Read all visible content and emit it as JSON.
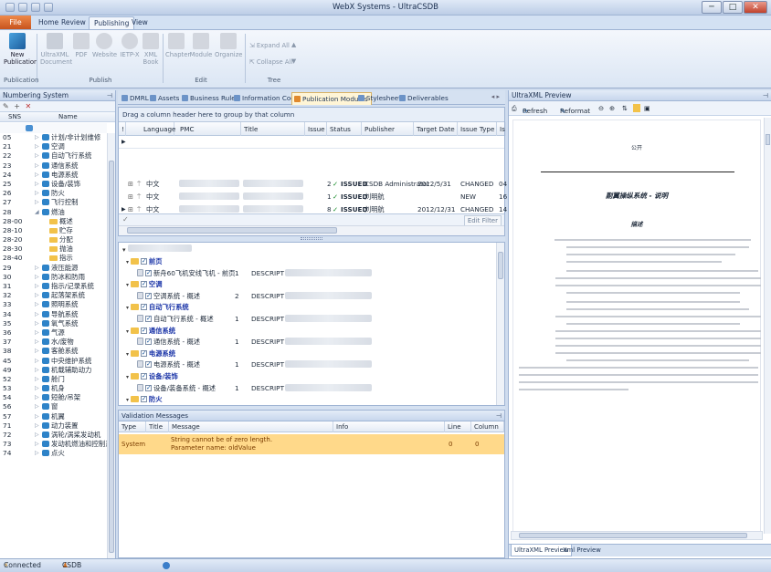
{
  "window": {
    "title": "WebX Systems - UltraCSDB",
    "minimize": "─",
    "maximize": "□",
    "close": "✕"
  },
  "ribbon": {
    "file_tab": "File",
    "tabs": [
      {
        "label": "Home"
      },
      {
        "label": "Review"
      },
      {
        "label": "Publishing"
      },
      {
        "label": "View"
      }
    ],
    "buttons": {
      "new_publication": "New Publication",
      "ultraxml_document": "UltraXML Document",
      "pdf": "PDF",
      "website": "Website",
      "ietp": "IETP-X",
      "xml_book": "XML Book",
      "chapter": "Chapter",
      "module": "Module",
      "organize": "Organize",
      "expand_all": "Expand All",
      "collapse_all": "Collapse All"
    },
    "groups": {
      "publication": "Publication",
      "publish": "Publish",
      "edit": "Edit",
      "tree": "Tree"
    }
  },
  "numbering": {
    "title": "Numbering System",
    "col_sns": "SNS",
    "col_name": "Name",
    "rows": [
      {
        "sns": "05",
        "name": "计划/非计划维修"
      },
      {
        "sns": "21",
        "name": "空调"
      },
      {
        "sns": "22",
        "name": "自动飞行系统"
      },
      {
        "sns": "23",
        "name": "通信系统"
      },
      {
        "sns": "24",
        "name": "电源系统"
      },
      {
        "sns": "25",
        "name": "设备/装饰"
      },
      {
        "sns": "26",
        "name": "防火"
      },
      {
        "sns": "27",
        "name": "飞行控制"
      },
      {
        "sns": "28",
        "name": "燃油"
      },
      {
        "sns": "28-00",
        "name": "概述"
      },
      {
        "sns": "28-10",
        "name": "贮存"
      },
      {
        "sns": "28-20",
        "name": "分配"
      },
      {
        "sns": "28-30",
        "name": "抛油"
      },
      {
        "sns": "28-40",
        "name": "指示"
      },
      {
        "sns": "29",
        "name": "液压能源"
      },
      {
        "sns": "30",
        "name": "防冰和防雨"
      },
      {
        "sns": "31",
        "name": "指示/记录系统"
      },
      {
        "sns": "32",
        "name": "起落架系统"
      },
      {
        "sns": "33",
        "name": "照明系统"
      },
      {
        "sns": "34",
        "name": "导航系统"
      },
      {
        "sns": "35",
        "name": "氧气系统"
      },
      {
        "sns": "36",
        "name": "气源"
      },
      {
        "sns": "37",
        "name": "水/废物"
      },
      {
        "sns": "38",
        "name": "客舱系统"
      },
      {
        "sns": "45",
        "name": "中央维护系统"
      },
      {
        "sns": "49",
        "name": "机载辅助动力"
      },
      {
        "sns": "52",
        "name": "舱门"
      },
      {
        "sns": "53",
        "name": "机身"
      },
      {
        "sns": "54",
        "name": "短舱/吊架"
      },
      {
        "sns": "56",
        "name": "窗"
      },
      {
        "sns": "57",
        "name": "机翼"
      },
      {
        "sns": "71",
        "name": "动力装置"
      },
      {
        "sns": "72",
        "name": "涡轮/涡桨发动机"
      },
      {
        "sns": "73",
        "name": "发动机燃油和控制系统"
      },
      {
        "sns": "74",
        "name": "点火"
      }
    ]
  },
  "doc_tabs": [
    {
      "label": "DMRL"
    },
    {
      "label": "Assets"
    },
    {
      "label": "Business Rules"
    },
    {
      "label": "Information Codes"
    },
    {
      "label": "Publication Modules"
    },
    {
      "label": "Stylesheets"
    },
    {
      "label": "Deliverables"
    }
  ],
  "grid": {
    "group_hint": "Drag a column header here to group by that column",
    "columns": [
      "!",
      "Language",
      "PMC",
      "Title",
      "Issue",
      "Status",
      "Publisher",
      "Target Date",
      "Issue Type",
      "Is"
    ],
    "rows": [
      {
        "language": "中文",
        "issue": "2",
        "status": "ISSUED",
        "publisher": "CSDB Administrator",
        "date": "2012/5/31",
        "type": "CHANGED",
        "is": "04"
      },
      {
        "language": "中文",
        "issue": "1",
        "status": "ISSUED",
        "publisher": "刘明航",
        "date": "",
        "type": "NEW",
        "is": "16"
      },
      {
        "language": "中文",
        "issue": "8",
        "status": "ISSUED",
        "publisher": "刘明航",
        "date": "2012/12/31",
        "type": "CHANGED",
        "is": "14"
      }
    ],
    "edit_filter": "Edit Filter"
  },
  "tree": {
    "rows": [
      {
        "type": "folder",
        "label": "前页"
      },
      {
        "type": "leaf",
        "label": "新舟60飞机安线飞机 - 前页",
        "num": "1",
        "desc": "DESCRIPT"
      },
      {
        "type": "folder",
        "label": "空调"
      },
      {
        "type": "leaf",
        "label": "空调系统 - 概述",
        "num": "2",
        "desc": "DESCRIPT"
      },
      {
        "type": "folder",
        "label": "自动飞行系统"
      },
      {
        "type": "leaf",
        "label": "自动飞行系统 - 概述",
        "num": "1",
        "desc": "DESCRIPT"
      },
      {
        "type": "folder",
        "label": "通信系统"
      },
      {
        "type": "leaf",
        "label": "通信系统 - 概述",
        "num": "1",
        "desc": "DESCRIPT"
      },
      {
        "type": "folder",
        "label": "电源系统"
      },
      {
        "type": "leaf",
        "label": "电源系统 - 概述",
        "num": "1",
        "desc": "DESCRIPT"
      },
      {
        "type": "folder",
        "label": "设备/装饰"
      },
      {
        "type": "leaf",
        "label": "设备/装备系统 - 概述",
        "num": "1",
        "desc": "DESCRIPT"
      },
      {
        "type": "folder",
        "label": "防火"
      }
    ]
  },
  "validation": {
    "title": "Validation Messages",
    "columns": [
      "Type",
      "Title",
      "Message",
      "Info",
      "Line",
      "Column"
    ],
    "rows": [
      {
        "type": "System",
        "title": "",
        "message_1": "String cannot be of zero length.",
        "message_2": "Parameter name: oldValue",
        "info": "",
        "line": "0",
        "column": "0"
      }
    ]
  },
  "preview": {
    "title": "UltraXML Preview",
    "refresh": "Refresh",
    "reformat": "Reformat",
    "doc": {
      "header": "公开",
      "title": "副翼操纵系统 - 说明",
      "heading": "描述"
    },
    "tabs": [
      {
        "label": "UltraXML Preview"
      },
      {
        "label": "Xml Preview"
      }
    ]
  },
  "status": {
    "connection": "Connected",
    "user": "CSDB Administrator"
  }
}
